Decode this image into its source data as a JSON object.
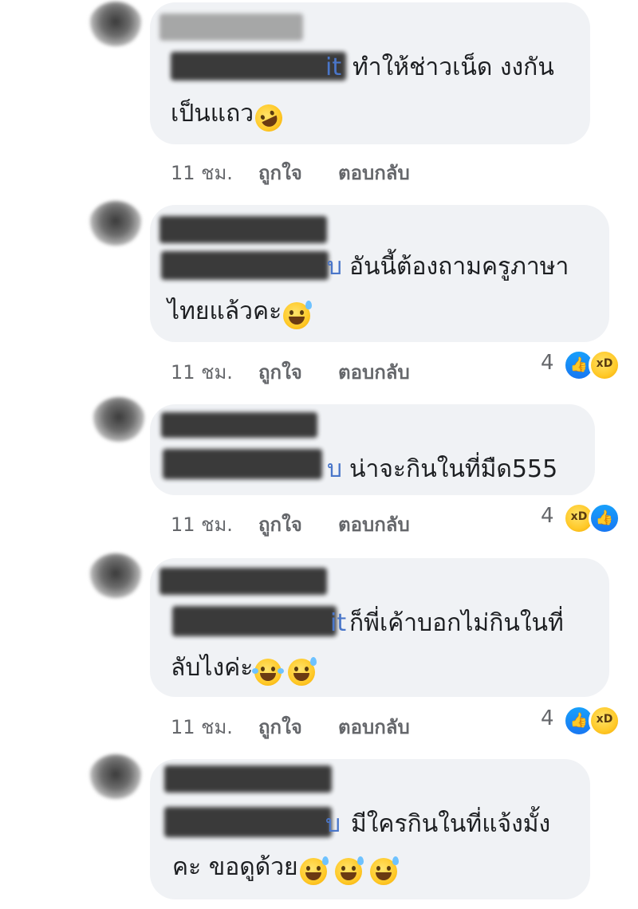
{
  "comments": [
    {
      "mention_tail": "it",
      "line1": "ทำให้ช่าวเน็ด งงกัน",
      "line2": "เป็นแถว",
      "emojis": [
        "rofl"
      ],
      "meta": {
        "time": "11 ชม.",
        "like": "ถูกใจ",
        "reply": "ตอบกลับ"
      },
      "reactions": null
    },
    {
      "mention_tail": "บ",
      "line1": "อันนี้ต้องถามครูภาษา",
      "line2": "ไทยแล้วคะ",
      "emojis": [
        "sweat"
      ],
      "meta": {
        "time": "11 ชม.",
        "like": "ถูกใจ",
        "reply": "ตอบกลับ"
      },
      "reactions": {
        "count": "4",
        "icons": [
          "like-icon",
          "haha-icon"
        ]
      }
    },
    {
      "mention_tail": "บ",
      "line1": "น่าจะกินในที่มืด555",
      "line2": "",
      "emojis": [],
      "meta": {
        "time": "11 ชม.",
        "like": "ถูกใจ",
        "reply": "ตอบกลับ"
      },
      "reactions": {
        "count": "4",
        "icons": [
          "haha-icon",
          "like-icon"
        ]
      }
    },
    {
      "mention_tail": "it",
      "line1": "ก็พี่เค้าบอกไม่กินในที่",
      "line2": "ลับไงค่ะ",
      "emojis": [
        "tears",
        "sweat"
      ],
      "meta": {
        "time": "11 ชม.",
        "like": "ถูกใจ",
        "reply": "ตอบกลับ"
      },
      "reactions": {
        "count": "4",
        "icons": [
          "like-icon",
          "haha-icon"
        ]
      }
    },
    {
      "mention_tail": "บ",
      "line1": "มีใครกินในที่แจ้งมั้ง",
      "line2": "คะ ขอดูด้วย",
      "emojis": [
        "sweat",
        "sweat",
        "sweat"
      ],
      "meta": null,
      "reactions": null
    }
  ],
  "colors": {
    "bubble": "#f0f2f5",
    "mention": "#4a76c9",
    "meta": "#65676b",
    "like_blue": "#1877f2"
  }
}
